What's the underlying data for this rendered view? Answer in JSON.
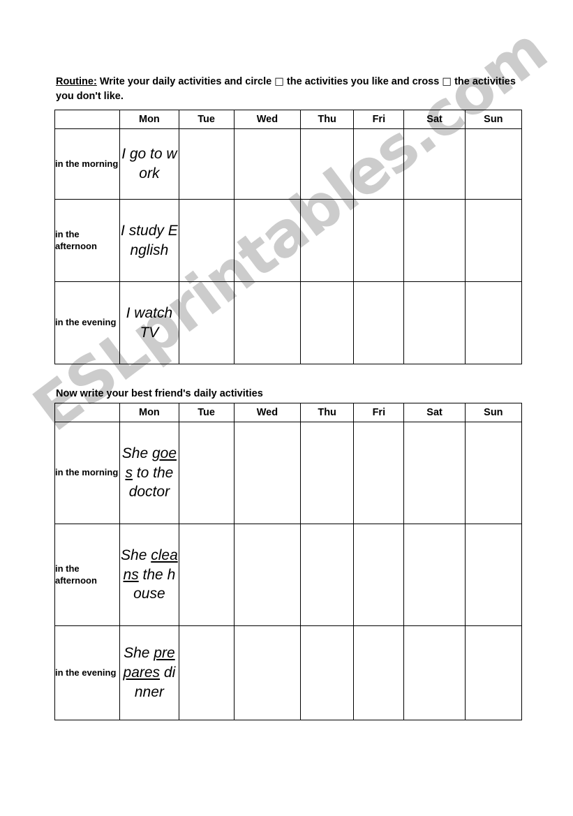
{
  "watermark": {
    "text": "ESLprintables.com"
  },
  "instructions": {
    "lead_label": "Routine:",
    "text_part_1": " Write your daily activities and circle ",
    "symbol_circle": "□",
    "text_part_2": " the activities you like and cross ",
    "symbol_cross": "□",
    "text_part_3": " the activities you don't like."
  },
  "subinstruction": {
    "text": "Now write your best friend's daily activities"
  },
  "columns": {
    "label": "",
    "days": [
      "Mon",
      "Tue",
      "Wed",
      "Thu",
      "Fri",
      "Sat",
      "Sun"
    ]
  },
  "dayparts": {
    "morning": "in the morning",
    "afternoon": "in the afternoon",
    "evening": "in the evening"
  },
  "table_self": {
    "morning": {
      "mon_plain": "I go to work",
      "mon_before": "I go to work",
      "mon_underlined": "",
      "mon_after": ""
    },
    "afternoon": {
      "mon_before": "I study English",
      "mon_underlined": "",
      "mon_after": ""
    },
    "evening": {
      "mon_before": "I watch TV",
      "mon_underlined": "",
      "mon_after": ""
    }
  },
  "table_friend": {
    "morning": {
      "mon_before": "She ",
      "mon_underlined": "goes",
      "mon_after": " to the doctor"
    },
    "afternoon": {
      "mon_before": "She ",
      "mon_underlined": "cleans",
      "mon_after": " the house"
    },
    "evening": {
      "mon_before": "She ",
      "mon_underlined": "prepares",
      "mon_after": " dinner"
    }
  }
}
